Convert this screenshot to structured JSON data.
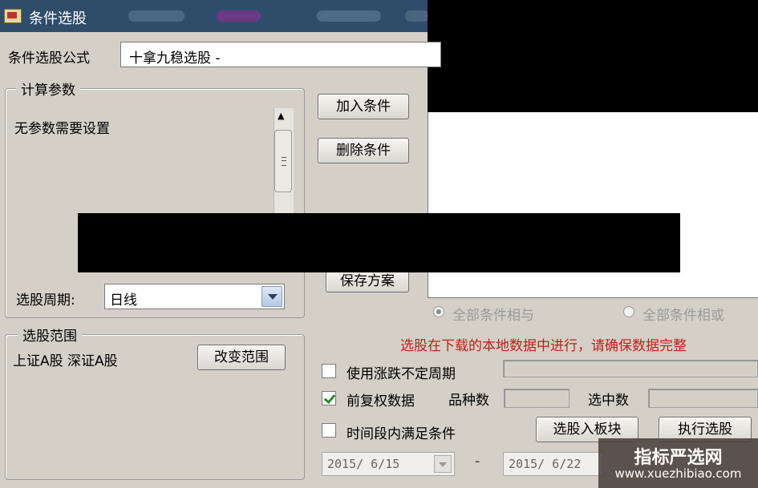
{
  "window": {
    "title": "条件选股"
  },
  "formula": {
    "label": "条件选股公式",
    "value": "十拿九稳选股 -"
  },
  "params": {
    "legend": "计算参数",
    "message": "无参数需要设置"
  },
  "buttons": {
    "add": "加入条件",
    "delete": "删除条件",
    "save": "保存方案",
    "change_range": "改变范围",
    "to_block": "选股入板块",
    "execute": "执行选股"
  },
  "period": {
    "label": "选股周期:",
    "value": "日线"
  },
  "range": {
    "legend": "选股范围",
    "value": "上证A股 深证A股"
  },
  "logic": {
    "all_and": "全部条件相与",
    "all_or": "全部条件相或",
    "selected": "all_and"
  },
  "warning": "选股在下载的本地数据中进行，请确保数据完整",
  "options": {
    "volatile_period": {
      "label": "使用涨跌不定周期",
      "checked": false
    },
    "adjusted_data": {
      "label": "前复权数据",
      "checked": true
    },
    "time_range": {
      "label": "时间段内满足条件",
      "checked": false
    }
  },
  "stats": {
    "variety_label": "品种数",
    "selected_label": "选中数"
  },
  "dates": {
    "start": "2015/ 6/15",
    "separator": "-",
    "end": "2015/ 6/22"
  },
  "watermark": {
    "title": "指标严选网",
    "url": "www.xuezhibiao.com"
  },
  "icons": {
    "app": "app-icon",
    "scroll_up": "scroll-up-icon",
    "grip": "scroll-grip-icon",
    "dropdown": "chevron-down-icon"
  }
}
